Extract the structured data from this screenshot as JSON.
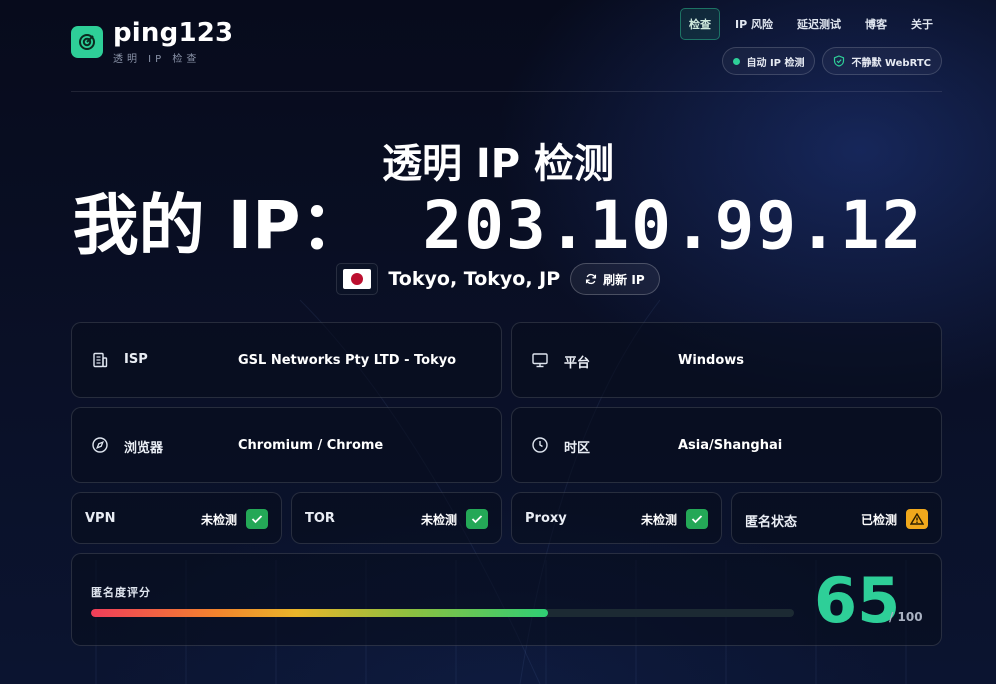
{
  "brand": {
    "name": "ping123",
    "subtitle": "透明 IP 检查"
  },
  "nav": [
    "检查",
    "IP 风险",
    "延迟测试",
    "博客",
    "关于"
  ],
  "pills": {
    "auto_detect": "自动 IP 检测",
    "webrtc": "不静默 WebRTC"
  },
  "hero": {
    "title": "透明 IP 检测",
    "ip_label": "我的 IP：",
    "ip": "203.10.99.12",
    "location": "Tokyo, Tokyo, JP",
    "refresh": "刷新 IP"
  },
  "info": {
    "isp": {
      "label": "ISP",
      "value": "GSL Networks Pty LTD - Tokyo"
    },
    "platform": {
      "label": "平台",
      "value": "Windows"
    },
    "browser": {
      "label": "浏览器",
      "value": "Chromium / Chrome"
    },
    "timezone": {
      "label": "时区",
      "value": "Asia/Shanghai"
    }
  },
  "checks": [
    {
      "label": "VPN",
      "status": "未检测",
      "level": "ok"
    },
    {
      "label": "TOR",
      "status": "未检测",
      "level": "ok"
    },
    {
      "label": "Proxy",
      "status": "未检测",
      "level": "ok"
    },
    {
      "label": "匿名状态",
      "status": "已检测",
      "level": "warn"
    }
  ],
  "score": {
    "label": "匿名度评分",
    "value": "65",
    "max": "/ 100",
    "fraction": 0.65
  },
  "colors": {
    "accent": "#2ecf98",
    "ok": "#24a857",
    "warn": "#f0a81c"
  }
}
